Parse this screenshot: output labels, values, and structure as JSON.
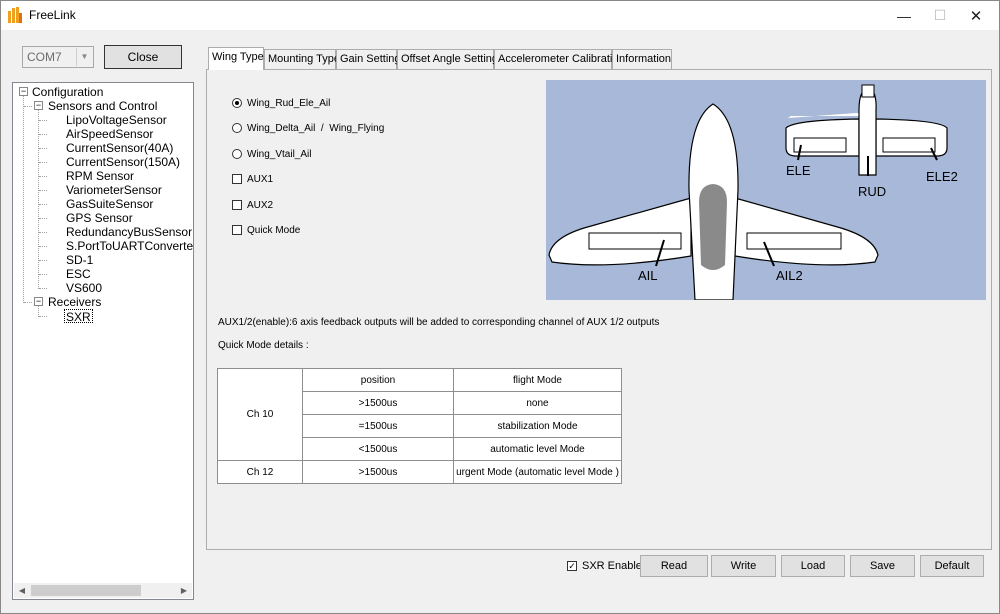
{
  "window": {
    "title": "FreeLink"
  },
  "controls": {
    "minimize": "—",
    "maximize": "☐",
    "close": "✕"
  },
  "port": {
    "selected": "COM7",
    "close_label": "Close"
  },
  "tree": {
    "root": "Configuration",
    "sensors_group": "Sensors and Control",
    "sensors": [
      "LipoVoltageSensor",
      "AirSpeedSensor",
      "CurrentSensor(40A)",
      "CurrentSensor(150A)",
      "RPM Sensor",
      "VariometerSensor",
      "GasSuiteSensor",
      "GPS Sensor",
      "RedundancyBusSensor",
      "S.PortToUARTConverter S",
      "SD-1",
      "ESC",
      "VS600"
    ],
    "receivers_group": "Receivers",
    "receivers": [
      "SXR"
    ]
  },
  "tabs": [
    "Wing Type",
    "Mounting Type",
    "Gain Setting",
    "Offset Angle Setting",
    "Accelerometer Calibration",
    "Information"
  ],
  "options": {
    "radio1": "Wing_Rud_Ele_Ail",
    "radio2": "Wing_Delta_Ail  /  Wing_Flying",
    "radio3": "Wing_Vtail_Ail",
    "check1": "AUX1",
    "check2": "AUX2",
    "check3": "Quick Mode"
  },
  "diagram": {
    "ele": "ELE",
    "rud": "RUD",
    "ele2": "ELE2",
    "ail": "AIL",
    "ail2": "AIL2"
  },
  "notes": {
    "aux": "AUX1/2(enable):6 axis feedback outputs will be added to corresponding channel of AUX 1/2 outputs",
    "quick": "Quick Mode details :"
  },
  "table": {
    "ch10": "Ch 10",
    "ch12": "Ch 12",
    "header_position": "position",
    "header_mode": "flight Mode",
    "rows": [
      {
        "position": ">1500us",
        "mode": "none"
      },
      {
        "position": "=1500us",
        "mode": "stabilization Mode"
      },
      {
        "position": "<1500us",
        "mode": "automatic level Mode"
      }
    ],
    "ch12_row": {
      "position": ">1500us",
      "mode": "urgent Mode (automatic level Mode )"
    }
  },
  "footer": {
    "sxr_enable": "SXR Enable",
    "read": "Read",
    "write": "Write",
    "load": "Load",
    "save": "Save",
    "default": "Default"
  }
}
